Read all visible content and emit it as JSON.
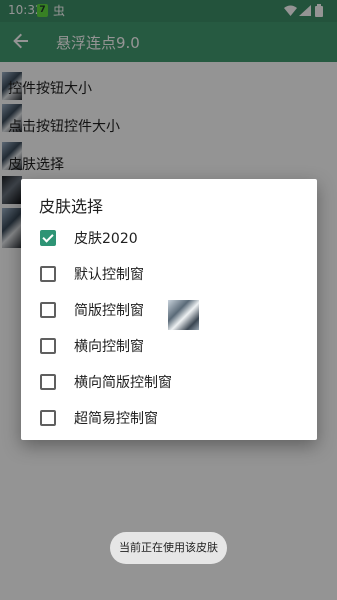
{
  "status_bar": {
    "time": "10:32",
    "notification_a": "7",
    "notification_b": "虫"
  },
  "app_bar": {
    "title": "悬浮连点9.0",
    "back_icon": "arrow-back-icon"
  },
  "settings": {
    "items": [
      {
        "label": "控件按钮大小"
      },
      {
        "label": "点击按钮控件大小"
      },
      {
        "label": "皮肤选择"
      }
    ]
  },
  "dialog": {
    "title": "皮肤选择",
    "options": [
      {
        "label": "皮肤2020",
        "checked": true
      },
      {
        "label": "默认控制窗",
        "checked": false
      },
      {
        "label": "简版控制窗",
        "checked": false
      },
      {
        "label": "横向控制窗",
        "checked": false
      },
      {
        "label": "横向简版控制窗",
        "checked": false
      },
      {
        "label": "超简易控制窗",
        "checked": false
      }
    ]
  },
  "toast": {
    "message": "当前正在使用该皮肤"
  },
  "colors": {
    "accent": "#2e9475",
    "app_bar": "#429c70",
    "status_bar": "#3d8f68"
  }
}
